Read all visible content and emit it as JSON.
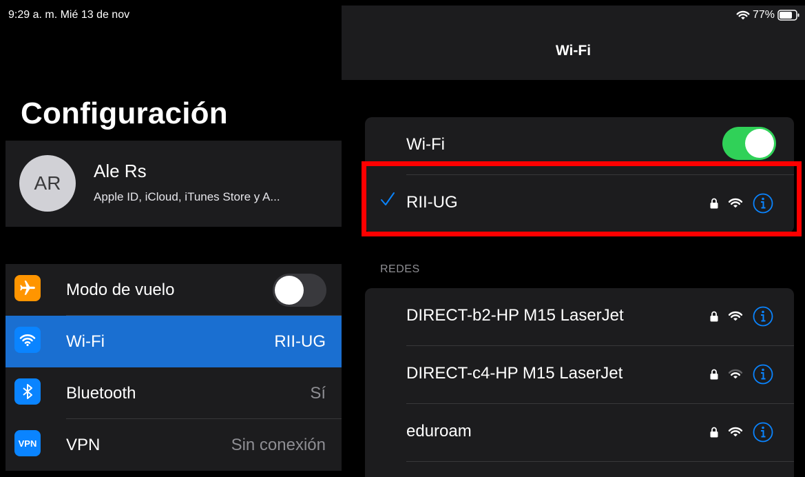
{
  "status_bar": {
    "time_date": "9:29 a. m.   Mié 13 de nov",
    "battery": "77%"
  },
  "sidebar": {
    "title": "Configuración",
    "profile": {
      "initials": "AR",
      "name": "Ale Rs",
      "subtitle": "Apple ID, iCloud, iTunes Store y A..."
    },
    "items": [
      {
        "label": "Modo de vuelo",
        "icon": "airplane-icon",
        "icon_color": "#ff9500",
        "toggle": "off"
      },
      {
        "label": "Wi-Fi",
        "value": "RII-UG",
        "icon": "wifi-icon",
        "icon_color": "#0a84ff",
        "selected": true
      },
      {
        "label": "Bluetooth",
        "value": "Sí",
        "icon": "bluetooth-icon",
        "icon_color": "#0a84ff"
      },
      {
        "label": "VPN",
        "value": "Sin conexión",
        "icon": "vpn-icon",
        "icon_text": "VPN",
        "icon_color": "#0a84ff"
      }
    ]
  },
  "detail": {
    "nav_title": "Wi-Fi",
    "wifi_toggle": {
      "label": "Wi-Fi",
      "state": "on"
    },
    "connected_network": {
      "name": "RII-UG",
      "secured": true,
      "signal": "full"
    },
    "networks_header": "REDES",
    "networks": [
      {
        "name": "DIRECT-b2-HP M15 LaserJet",
        "secured": true,
        "signal": "full"
      },
      {
        "name": "DIRECT-c4-HP M15 LaserJet",
        "secured": true,
        "signal": "weak"
      },
      {
        "name": "eduroam",
        "secured": true,
        "signal": "full"
      }
    ]
  },
  "colors": {
    "accent": "#0a84ff",
    "toggle_on": "#30d158",
    "highlight": "#ff0000"
  }
}
